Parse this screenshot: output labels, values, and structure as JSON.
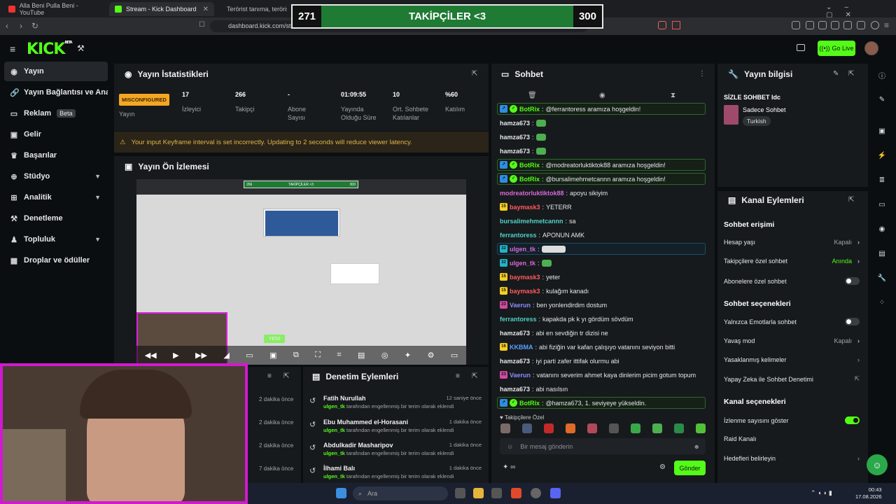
{
  "browser": {
    "tabs": [
      {
        "title": "Alla Beni Pulla Beni - YouTube"
      },
      {
        "title": "Stream - Kick Dashboard"
      },
      {
        "title": "Terörist tanıma, terörist tanı"
      }
    ],
    "url": "dashboard.kick.com/st"
  },
  "overlay": {
    "left": "271",
    "title": "TAKİPÇİLER <3",
    "right": "300"
  },
  "header": {
    "logo": "KICK",
    "logo_sup": "BETA",
    "go_live": "Go Live"
  },
  "sidebar": {
    "items": [
      {
        "label": "Yayın",
        "icon": "broadcast-icon"
      },
      {
        "label": "Yayın Bağlantısı ve Anahtarı",
        "icon": "link-icon"
      },
      {
        "label": "Reklam",
        "badge": "Beta",
        "icon": "ad-icon"
      },
      {
        "label": "Gelir",
        "icon": "money-icon"
      },
      {
        "label": "Başarılar",
        "icon": "trophy-icon"
      },
      {
        "label": "Stüdyo",
        "icon": "studio-icon"
      },
      {
        "label": "Analitik",
        "icon": "chart-icon"
      },
      {
        "label": "Denetleme",
        "icon": "hammer-icon"
      },
      {
        "label": "Topluluk",
        "icon": "community-icon"
      },
      {
        "label": "Droplar ve ödüller",
        "icon": "gift-icon"
      }
    ]
  },
  "stats": {
    "title": "Yayın İstatistikleri",
    "status": "MISCONFIGURED",
    "status_label": "Yayın",
    "items": [
      {
        "value": "17",
        "label": "İzleyici"
      },
      {
        "value": "266",
        "label": "Takipçi"
      },
      {
        "value": "-",
        "label": "Abone Sayısı"
      },
      {
        "value": "01:09:55",
        "label": "Yayında Olduğu Süre"
      },
      {
        "value": "10",
        "label": "Ort. Sohbete Katılanlar"
      },
      {
        "value": "%60",
        "label": "Katılım"
      }
    ],
    "warning": "Your input Keyframe interval is set incorrectly. Updating to 2 seconds will reduce viewer latency."
  },
  "preview": {
    "title": "Yayın Ön İzlemesi",
    "overlay_left": "266",
    "overlay_title": "TAKİPÇİLER <3",
    "overlay_right": "300",
    "new_badge": "YENİ"
  },
  "left_lower": {
    "times": [
      "2 dakika önce",
      "2 dakika önce",
      "2 dakika önce",
      "7 dakika önce"
    ]
  },
  "moderation": {
    "title": "Denetim Eylemleri",
    "items": [
      {
        "name": "Fatih Nurullah",
        "time": "12 saniye önce",
        "user": "ulgen_tk",
        "desc": " tarafından engellenmiş bir terim olarak eklendi"
      },
      {
        "name": "Ebu Muhammed el-Horasani",
        "time": "1 dakika önce",
        "user": "ulgen_tk",
        "desc": " tarafından engellenmiş bir terim olarak eklendi"
      },
      {
        "name": "Abdulkadir Masharipov",
        "time": "1 dakika önce",
        "user": "ulgen_tk",
        "desc": " tarafından engellenmiş bir terim olarak eklendi"
      },
      {
        "name": "İlhami Balı",
        "time": "1 dakika önce",
        "user": "ulgen_tk",
        "desc": " tarafından engellenmiş bir terim olarak eklendi"
      }
    ]
  },
  "chat": {
    "title": "Sohbet",
    "messages": [
      {
        "user": "BotRix",
        "text": "@ferrantoress aramıza hoşgeldin!",
        "color": "#53fc18",
        "type": "bot"
      },
      {
        "user": "hamza673",
        "text": "",
        "color": "#e5e7eb",
        "emote": true
      },
      {
        "user": "hamza673",
        "text": "",
        "color": "#e5e7eb",
        "emote": true
      },
      {
        "user": "hamza673",
        "text": "",
        "color": "#e5e7eb",
        "emote": true
      },
      {
        "user": "BotRix",
        "text": "@modreatorluktiktok88 aramıza hoşgeldin!",
        "color": "#53fc18",
        "type": "bot"
      },
      {
        "user": "BotRix",
        "text": "@bursalimehmetcannn aramıza hoşgeldin!",
        "color": "#53fc18",
        "type": "bot"
      },
      {
        "user": "modreatorluktiktok88",
        "text": "apoyu sikiyim",
        "color": "#d66ad6"
      },
      {
        "user": "baymask3",
        "text": "YETERR",
        "color": "#ff5b5b",
        "badge": "15"
      },
      {
        "user": "bursalimehmetcannn",
        "text": "sa",
        "color": "#4fd1c5"
      },
      {
        "user": "ferrantoress",
        "text": "APONUN AMK",
        "color": "#4fd1c5"
      },
      {
        "user": "ulgen_tk",
        "text": "",
        "color": "#d66ad6",
        "type": "hl",
        "badge": "32",
        "emote": true
      },
      {
        "user": "ulgen_tk",
        "text": "",
        "color": "#d66ad6",
        "badge": "32",
        "emote": true
      },
      {
        "user": "baymask3",
        "text": "yeter",
        "color": "#ff5b5b",
        "badge": "15"
      },
      {
        "user": "baymask3",
        "text": "kulağım kanadı",
        "color": "#ff5b5b",
        "badge": "15"
      },
      {
        "user": "Vaerun",
        "text": "ben yonlendirdim dostum",
        "color": "#8b8bff",
        "badge": "23"
      },
      {
        "user": "ferrantoress",
        "text": "kapakda pk k yı gördüm sövdüm",
        "color": "#4fd1c5"
      },
      {
        "user": "hamza673",
        "text": "abi en sevdiğin tr dizisi ne",
        "color": "#e5e7eb"
      },
      {
        "user": "KKBMA",
        "text": "abi fiziğin var kafan çalışıyo vatanını seviyon bitti",
        "color": "#5aa0ff",
        "badge": "16"
      },
      {
        "user": "hamza673",
        "text": "iyi parti zafer ittifak olurmu abi",
        "color": "#e5e7eb"
      },
      {
        "user": "Vaerun",
        "text": "vatanını severim ahmet kaya dinlerim picim gotum topum",
        "color": "#8b8bff",
        "badge": "23"
      },
      {
        "user": "hamza673",
        "text": "abi nasılsın",
        "color": "#e5e7eb"
      },
      {
        "user": "BotRix",
        "text": "@hamza673, 1. seviyeye yükseldin.",
        "color": "#53fc18",
        "type": "bot"
      }
    ],
    "emote_bar_label": "Takipçilere Özel",
    "placeholder": "Bir mesaj gönderin",
    "send": "Gönder"
  },
  "stream_info": {
    "title": "Yayın bilgisi",
    "stream_title": "SİZLE SOHBET Idc",
    "category": "Sadece Sohbet",
    "tag": "Turkish"
  },
  "channel_actions": {
    "title": "Kanal Eylemleri",
    "chat_access": "Sohbet erişimi",
    "account_age": {
      "label": "Hesap yaşı",
      "value": "Kapalı"
    },
    "followers_only": {
      "label": "Takipçilere özel sohbet",
      "value": "Anında"
    },
    "subscribers_only": {
      "label": "Abonelere özel sohbet",
      "on": false
    },
    "chat_options": "Sohbet seçenekleri",
    "emote_only": {
      "label": "Yalnızca Emotlarla sohbet",
      "on": false
    },
    "slow_mode": {
      "label": "Yavaş mod",
      "value": "Kapalı"
    },
    "banned_words": {
      "label": "Yasaklanmış kelimeler"
    },
    "ai_mod": {
      "label": "Yapay Zeka ile Sohbet Denetimi"
    },
    "channel_options": "Kanal seçenekleri",
    "show_viewers": {
      "label": "İzlenme sayısını göster",
      "on": true
    },
    "raid": {
      "label": "Raid Kanalı"
    },
    "goals": {
      "label": "Hedefleri belirleyin"
    }
  },
  "taskbar": {
    "search": "Ara",
    "time": "00:43",
    "date": "17.08.2026"
  },
  "colors": {
    "accent": "#53fc18",
    "panel": "#171a1d",
    "warning": "#f5a623"
  }
}
